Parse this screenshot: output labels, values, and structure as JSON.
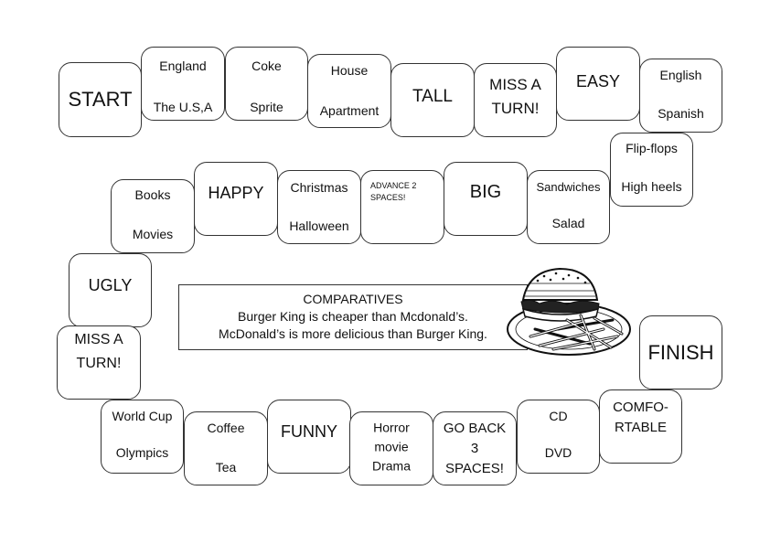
{
  "board": {
    "start": "START",
    "finish": "FINISH",
    "tiles": [
      {
        "id": "england",
        "top": "England",
        "bottom": "The U.S,A"
      },
      {
        "id": "coke",
        "top": "Coke",
        "bottom": "Sprite"
      },
      {
        "id": "house",
        "top": "House",
        "bottom": "Apartment"
      },
      {
        "id": "tall",
        "label": "TALL"
      },
      {
        "id": "miss1",
        "label": "MISS A\nTURN!"
      },
      {
        "id": "easy",
        "label": "EASY"
      },
      {
        "id": "english",
        "top": "English",
        "bottom": "Spanish"
      },
      {
        "id": "flipflops",
        "top": "Flip-flops",
        "bottom": "High heels"
      },
      {
        "id": "sandwiches",
        "top": "Sandwiches",
        "bottom": "Salad"
      },
      {
        "id": "big",
        "label": "BIG"
      },
      {
        "id": "advance",
        "label": "ADVANCE 2\nSPACES!"
      },
      {
        "id": "christmas",
        "top": "Christmas",
        "bottom": "Halloween"
      },
      {
        "id": "happy",
        "label": "HAPPY"
      },
      {
        "id": "books",
        "top": "Books",
        "bottom": "Movies"
      },
      {
        "id": "ugly",
        "label": "UGLY"
      },
      {
        "id": "miss2",
        "label": "MISS A\nTURN!"
      },
      {
        "id": "worldcup",
        "top": "World Cup",
        "bottom": "Olympics"
      },
      {
        "id": "coffee",
        "top": "Coffee",
        "bottom": "Tea"
      },
      {
        "id": "funny",
        "label": "FUNNY"
      },
      {
        "id": "horror",
        "lines": [
          "Horror",
          "movie",
          "Drama"
        ]
      },
      {
        "id": "goback",
        "lines": [
          "GO BACK",
          "3",
          "SPACES!"
        ]
      },
      {
        "id": "cd",
        "top": "CD",
        "bottom": "DVD"
      },
      {
        "id": "comfortable",
        "label": "COMFO-\nRTABLE"
      }
    ]
  },
  "comparatives": {
    "title": "COMPARATIVES",
    "line1": "Burger King is cheaper than Mcdonald’s.",
    "line2": "McDonald’s is more delicious than Burger King."
  },
  "illustration": {
    "icon": "burger-and-fries-icon"
  }
}
